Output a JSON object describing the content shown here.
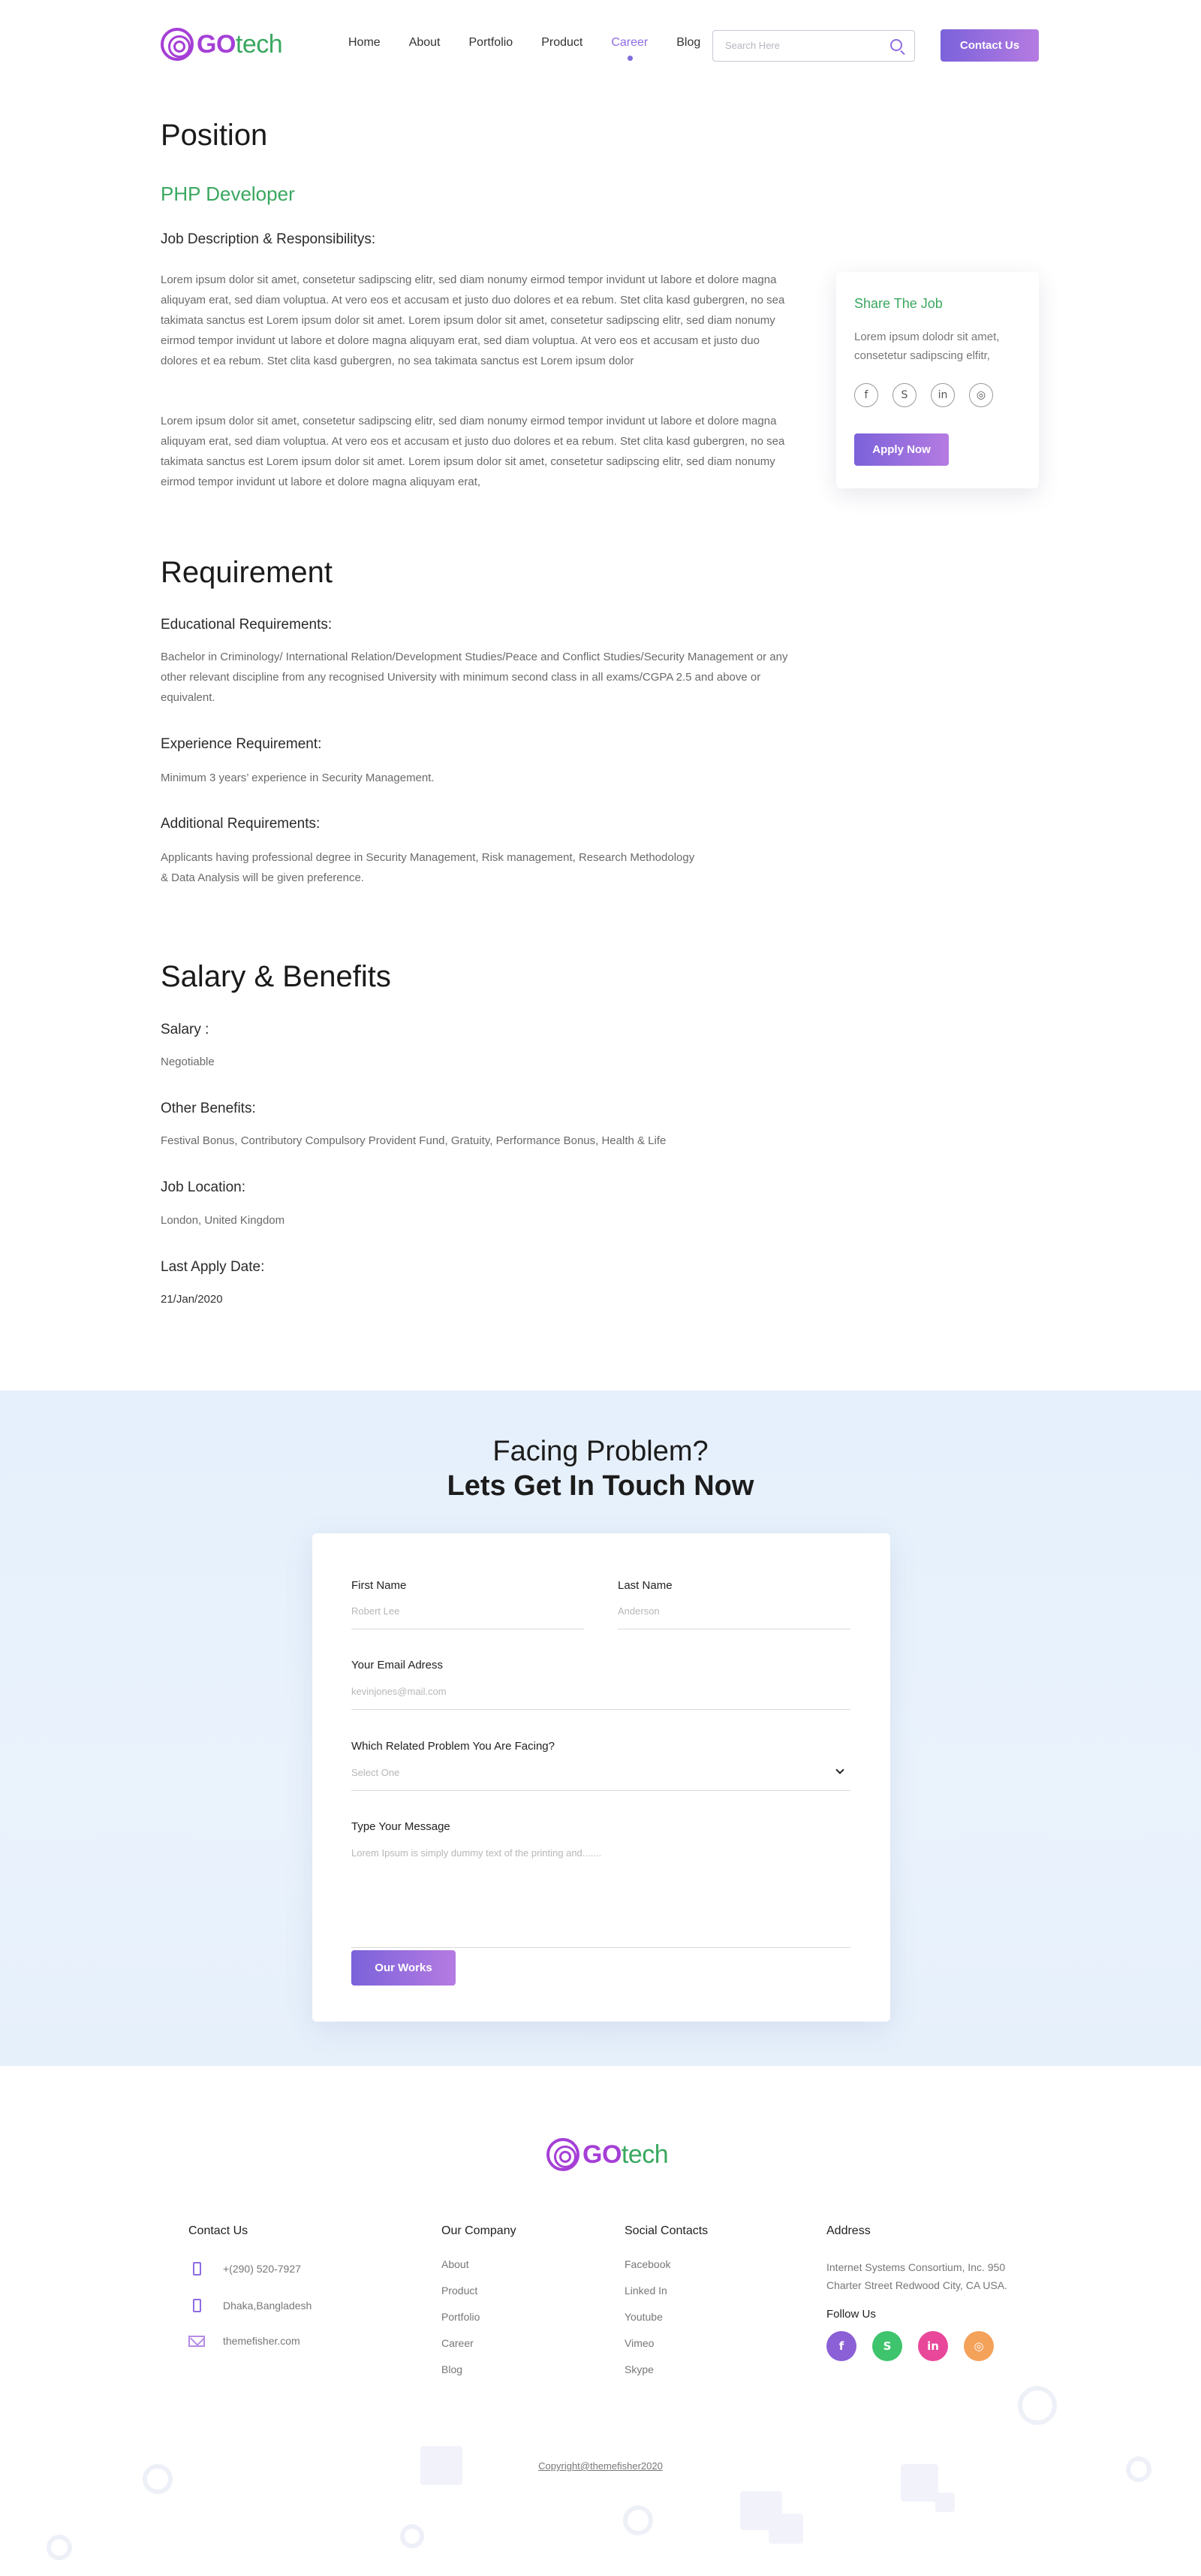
{
  "header": {
    "logo_go": "GO",
    "logo_tech": "tech",
    "nav": [
      "Home",
      "About",
      "Portfolio",
      "Product",
      "Career",
      "Blog"
    ],
    "active_nav": "Career",
    "search_placeholder": "Search Here",
    "contact_button": "Contact Us"
  },
  "position": {
    "heading": "Position",
    "job_title": "PHP Developer",
    "desc_heading": "Job Description & Responsibilitys:",
    "para1": "Lorem ipsum dolor sit amet, consetetur sadipscing elitr, sed diam nonumy eirmod tempor invidunt ut labore et dolore magna aliquyam erat, sed diam voluptua. At vero eos et accusam et justo duo dolores et ea rebum. Stet clita kasd gubergren, no sea takimata sanctus est Lorem ipsum dolor sit amet. Lorem ipsum dolor sit amet, consetetur sadipscing elitr, sed diam nonumy eirmod tempor invidunt ut labore et dolore magna aliquyam erat, sed diam voluptua. At vero eos et accusam et justo duo dolores et ea rebum. Stet clita kasd gubergren, no sea takimata sanctus est Lorem ipsum dolor",
    "para2": "Lorem ipsum dolor sit amet, consetetur sadipscing elitr, sed diam nonumy eirmod tempor invidunt ut labore et dolore magna aliquyam erat, sed diam voluptua. At vero eos et accusam et justo duo dolores et ea rebum. Stet clita kasd gubergren, no sea takimata sanctus est Lorem ipsum dolor sit amet. Lorem ipsum dolor sit amet, consetetur sadipscing elitr, sed diam nonumy eirmod tempor invidunt ut labore et dolore magna aliquyam erat,"
  },
  "share": {
    "title": "Share The Job",
    "text": "Lorem ipsum dolodr sit amet, consetetur sadipscing elfitr,",
    "icons": [
      "f",
      "S",
      "in",
      "◎"
    ],
    "apply_button": "Apply Now"
  },
  "requirement": {
    "heading": "Requirement",
    "edu_heading": "Educational Requirements:",
    "edu_text": "Bachelor in Criminology/ International Relation/Development Studies/Peace and Conflict Studies/Security Management or any other relevant discipline from any recognised University with minimum second class in all exams/CGPA 2.5 and above or equivalent.",
    "exp_heading": "Experience Requirement:",
    "exp_text": "Minimum 3 years’ experience in Security Management.",
    "add_heading": "Additional Requirements:",
    "add_text": "Applicants having professional degree in Security Management, Risk management, Research Methodology & Data Analysis will be given preference."
  },
  "salary": {
    "heading": "Salary & Benefits",
    "salary_heading": "Salary :",
    "salary_value": "Negotiable",
    "benefits_heading": "Other Benefits:",
    "benefits_value": "Festival Bonus, Contributory Compulsory Provident Fund, Gratuity, Performance Bonus, Health & Life",
    "location_heading": "Job Location:",
    "location_value": "London, United Kingdom",
    "date_heading": "Last Apply Date:",
    "date_value": "21/Jan/2020"
  },
  "contact_form": {
    "title_line1": "Facing Problem?",
    "title_line2": "Lets Get In Touch Now",
    "first_name_label": "First Name",
    "first_name_placeholder": "Robert Lee",
    "last_name_label": "Last Name",
    "last_name_placeholder": "Anderson",
    "email_label": "Your Email Adress",
    "email_placeholder": "kevinjones@mail.com",
    "problem_label": "Which Related Problem You Are Facing?",
    "problem_selected": "Select One",
    "message_label": "Type Your Message",
    "message_placeholder": "Lorem Ipsum is simply dummy text of the printing and.......",
    "submit_button": "Our Works"
  },
  "footer": {
    "logo_go": "GO",
    "logo_tech": "tech",
    "contact_title": "Contact Us",
    "phone": "+(290) 520-7927",
    "location": "Dhaka,Bangladesh",
    "website": "themefisher.com",
    "company_title": "Our Company",
    "company_links": [
      "About",
      "Product",
      "Portfolio",
      "Career",
      "Blog"
    ],
    "social_title": "Social Contacts",
    "social_links": [
      "Facebook",
      "Linked In",
      "Youtube",
      "Vimeo",
      "Skype"
    ],
    "address_title": "Address",
    "address_text": "Internet Systems Consortium, Inc. 950 Charter Street Redwood City, CA USA.",
    "follow_title": "Follow Us",
    "follow_icons": [
      "f",
      "S",
      "in",
      "◎"
    ],
    "copyright": "Copyright@themefisher2020"
  },
  "colors": {
    "accent_purple": "#8e6be3",
    "accent_green": "#39a85f",
    "facebook": "#8b5fd6",
    "skype": "#3ec46d",
    "linkedin": "#e8479a",
    "instagram": "#f4a15a"
  }
}
